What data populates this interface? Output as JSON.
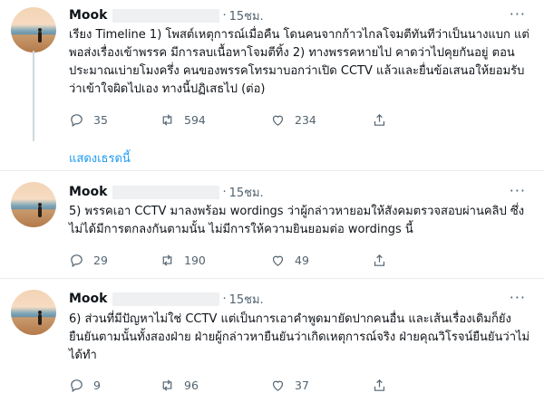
{
  "tweets": [
    {
      "name": "Mook",
      "time": "15ชม.",
      "text": "เรียง Timeline 1) โพสต์เหตุการณ์เมื่อคืน โดนคนจากก้าวไกลโจมตีทันทีว่าเป็นนางแบก แต่พอส่งเรื่องเข้าพรรค มีการลบเนื้อหาโจมตีทิ้ง 2) ทางพรรคหายไป คาดว่าไปคุยกันอยู่ ตอนประมาณเบ่ายโมงครึ่ง คนของพรรคโทรมาบอกว่าเปิด CCTV แล้วและยื่นข้อเสนอให้ยอมรับว่าเข้าใจผิดไปเอง ทางนี้ปฏิเสธไป (ต่อ)",
      "replies": "35",
      "retweets": "594",
      "likes": "234"
    },
    {
      "name": "Mook",
      "time": "15ชม.",
      "text": "5) พรรคเอา CCTV มาลงพร้อม wordings ว่าผู้กล่าวหายอมให้สังคมตรวจสอบผ่านคลิป ซึ่งไม่ได้มีการตกลงกันตามนั้น ไม่มีการให้ความยินยอมต่อ wordings นี้",
      "replies": "29",
      "retweets": "190",
      "likes": "49"
    },
    {
      "name": "Mook",
      "time": "15ชม.",
      "text": "6) ส่วนที่มีปัญหาไม่ใช่ CCTV แต่เป็นการเอาคำพูดมายัดปากคนอื่น และเส้นเรื่องเดิมก็ยังยืนยันตามนั้นทั้งสองฝ่าย ฝ่ายผู้กล่าวหายืนยันว่าเกิดเหตุการณ์จริง ฝ่ายคุณวิโรจน์ยืนยันว่าไม่ได้ทำ",
      "replies": "9",
      "retweets": "96",
      "likes": "37"
    }
  ],
  "show_thread": "แสดงเธรดนี้",
  "more_glyph": "···",
  "dot": "·",
  "icons": [
    "reply-icon",
    "retweet-icon",
    "like-icon",
    "share-icon",
    "more-icon"
  ],
  "colors": {
    "link": "#1d9bf0",
    "muted": "#536471",
    "divider": "#e6ecf0",
    "thread_line": "#cfd9de"
  }
}
